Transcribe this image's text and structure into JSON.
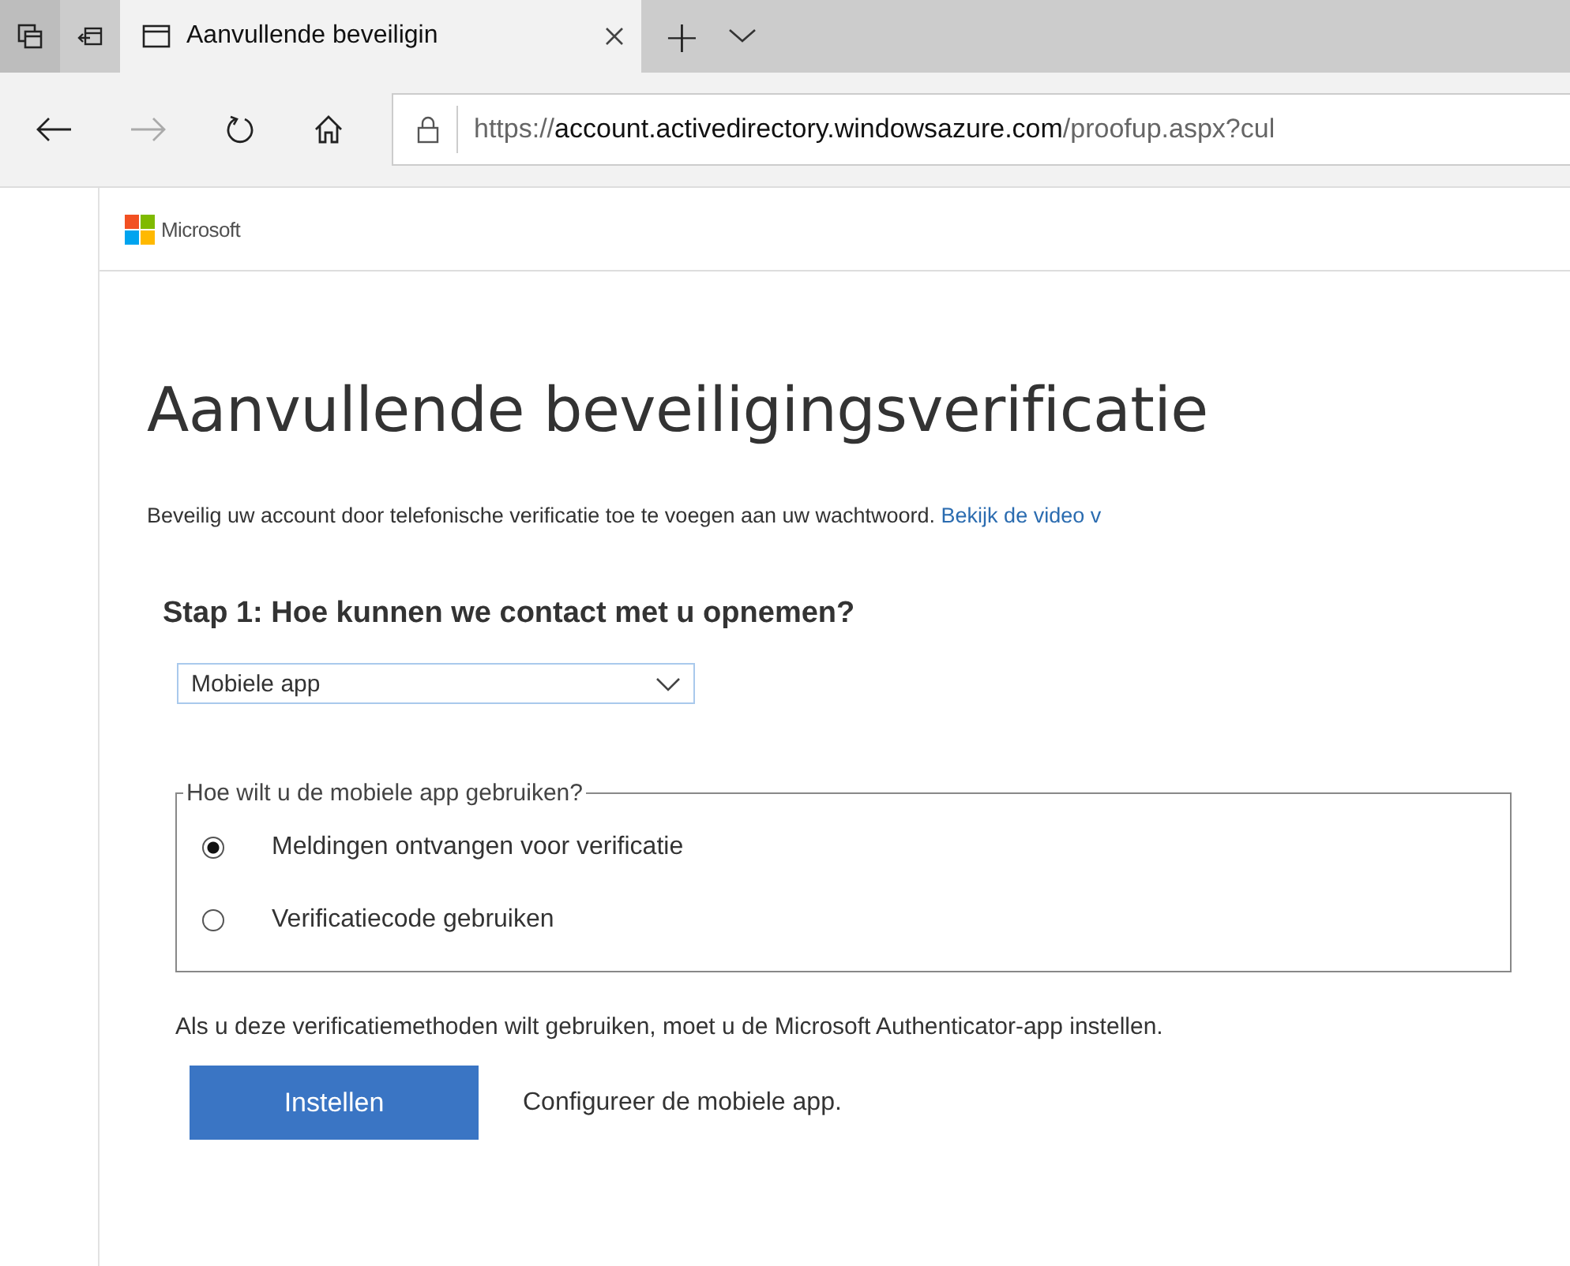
{
  "browser": {
    "tab": {
      "title": "Aanvullende beveiligin",
      "selected": true
    },
    "new_tab": "+",
    "address": {
      "scheme": "https://",
      "host": "account.activedirectory.windowsazure.com",
      "path": "/proofup.aspx?cul"
    }
  },
  "header": {
    "brand": "Microsoft"
  },
  "title": "Aanvullende beveiligingsverificatie",
  "intro": {
    "text": "Beveilig uw account door telefonische verificatie toe te voegen aan uw wachtwoord.",
    "link": "Bekijk de video v"
  },
  "step": {
    "heading": "Stap 1: Hoe kunnen we contact met u opnemen?",
    "select": {
      "value": "Mobiele app"
    },
    "group": {
      "legend": "Hoe wilt u de mobiele app gebruiken?",
      "options": [
        {
          "label": "Meldingen ontvangen voor verificatie",
          "selected": true
        },
        {
          "label": "Verificatiecode gebruiken",
          "selected": false
        }
      ]
    },
    "note": "Als u deze verificatiemethoden wilt gebruiken, moet u de Microsoft Authenticator-app instellen.",
    "button": "Instellen",
    "button_hint": "Configureer de mobiele app."
  }
}
